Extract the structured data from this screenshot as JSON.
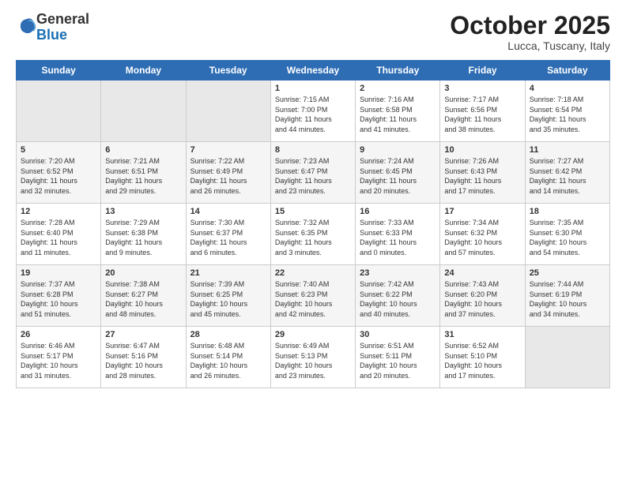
{
  "header": {
    "logo_line1": "General",
    "logo_line2": "Blue",
    "month_title": "October 2025",
    "location": "Lucca, Tuscany, Italy"
  },
  "weekdays": [
    "Sunday",
    "Monday",
    "Tuesday",
    "Wednesday",
    "Thursday",
    "Friday",
    "Saturday"
  ],
  "weeks": [
    [
      {
        "day": "",
        "info": ""
      },
      {
        "day": "",
        "info": ""
      },
      {
        "day": "",
        "info": ""
      },
      {
        "day": "1",
        "info": "Sunrise: 7:15 AM\nSunset: 7:00 PM\nDaylight: 11 hours\nand 44 minutes."
      },
      {
        "day": "2",
        "info": "Sunrise: 7:16 AM\nSunset: 6:58 PM\nDaylight: 11 hours\nand 41 minutes."
      },
      {
        "day": "3",
        "info": "Sunrise: 7:17 AM\nSunset: 6:56 PM\nDaylight: 11 hours\nand 38 minutes."
      },
      {
        "day": "4",
        "info": "Sunrise: 7:18 AM\nSunset: 6:54 PM\nDaylight: 11 hours\nand 35 minutes."
      }
    ],
    [
      {
        "day": "5",
        "info": "Sunrise: 7:20 AM\nSunset: 6:52 PM\nDaylight: 11 hours\nand 32 minutes."
      },
      {
        "day": "6",
        "info": "Sunrise: 7:21 AM\nSunset: 6:51 PM\nDaylight: 11 hours\nand 29 minutes."
      },
      {
        "day": "7",
        "info": "Sunrise: 7:22 AM\nSunset: 6:49 PM\nDaylight: 11 hours\nand 26 minutes."
      },
      {
        "day": "8",
        "info": "Sunrise: 7:23 AM\nSunset: 6:47 PM\nDaylight: 11 hours\nand 23 minutes."
      },
      {
        "day": "9",
        "info": "Sunrise: 7:24 AM\nSunset: 6:45 PM\nDaylight: 11 hours\nand 20 minutes."
      },
      {
        "day": "10",
        "info": "Sunrise: 7:26 AM\nSunset: 6:43 PM\nDaylight: 11 hours\nand 17 minutes."
      },
      {
        "day": "11",
        "info": "Sunrise: 7:27 AM\nSunset: 6:42 PM\nDaylight: 11 hours\nand 14 minutes."
      }
    ],
    [
      {
        "day": "12",
        "info": "Sunrise: 7:28 AM\nSunset: 6:40 PM\nDaylight: 11 hours\nand 11 minutes."
      },
      {
        "day": "13",
        "info": "Sunrise: 7:29 AM\nSunset: 6:38 PM\nDaylight: 11 hours\nand 9 minutes."
      },
      {
        "day": "14",
        "info": "Sunrise: 7:30 AM\nSunset: 6:37 PM\nDaylight: 11 hours\nand 6 minutes."
      },
      {
        "day": "15",
        "info": "Sunrise: 7:32 AM\nSunset: 6:35 PM\nDaylight: 11 hours\nand 3 minutes."
      },
      {
        "day": "16",
        "info": "Sunrise: 7:33 AM\nSunset: 6:33 PM\nDaylight: 11 hours\nand 0 minutes."
      },
      {
        "day": "17",
        "info": "Sunrise: 7:34 AM\nSunset: 6:32 PM\nDaylight: 10 hours\nand 57 minutes."
      },
      {
        "day": "18",
        "info": "Sunrise: 7:35 AM\nSunset: 6:30 PM\nDaylight: 10 hours\nand 54 minutes."
      }
    ],
    [
      {
        "day": "19",
        "info": "Sunrise: 7:37 AM\nSunset: 6:28 PM\nDaylight: 10 hours\nand 51 minutes."
      },
      {
        "day": "20",
        "info": "Sunrise: 7:38 AM\nSunset: 6:27 PM\nDaylight: 10 hours\nand 48 minutes."
      },
      {
        "day": "21",
        "info": "Sunrise: 7:39 AM\nSunset: 6:25 PM\nDaylight: 10 hours\nand 45 minutes."
      },
      {
        "day": "22",
        "info": "Sunrise: 7:40 AM\nSunset: 6:23 PM\nDaylight: 10 hours\nand 42 minutes."
      },
      {
        "day": "23",
        "info": "Sunrise: 7:42 AM\nSunset: 6:22 PM\nDaylight: 10 hours\nand 40 minutes."
      },
      {
        "day": "24",
        "info": "Sunrise: 7:43 AM\nSunset: 6:20 PM\nDaylight: 10 hours\nand 37 minutes."
      },
      {
        "day": "25",
        "info": "Sunrise: 7:44 AM\nSunset: 6:19 PM\nDaylight: 10 hours\nand 34 minutes."
      }
    ],
    [
      {
        "day": "26",
        "info": "Sunrise: 6:46 AM\nSunset: 5:17 PM\nDaylight: 10 hours\nand 31 minutes."
      },
      {
        "day": "27",
        "info": "Sunrise: 6:47 AM\nSunset: 5:16 PM\nDaylight: 10 hours\nand 28 minutes."
      },
      {
        "day": "28",
        "info": "Sunrise: 6:48 AM\nSunset: 5:14 PM\nDaylight: 10 hours\nand 26 minutes."
      },
      {
        "day": "29",
        "info": "Sunrise: 6:49 AM\nSunset: 5:13 PM\nDaylight: 10 hours\nand 23 minutes."
      },
      {
        "day": "30",
        "info": "Sunrise: 6:51 AM\nSunset: 5:11 PM\nDaylight: 10 hours\nand 20 minutes."
      },
      {
        "day": "31",
        "info": "Sunrise: 6:52 AM\nSunset: 5:10 PM\nDaylight: 10 hours\nand 17 minutes."
      },
      {
        "day": "",
        "info": ""
      }
    ]
  ]
}
